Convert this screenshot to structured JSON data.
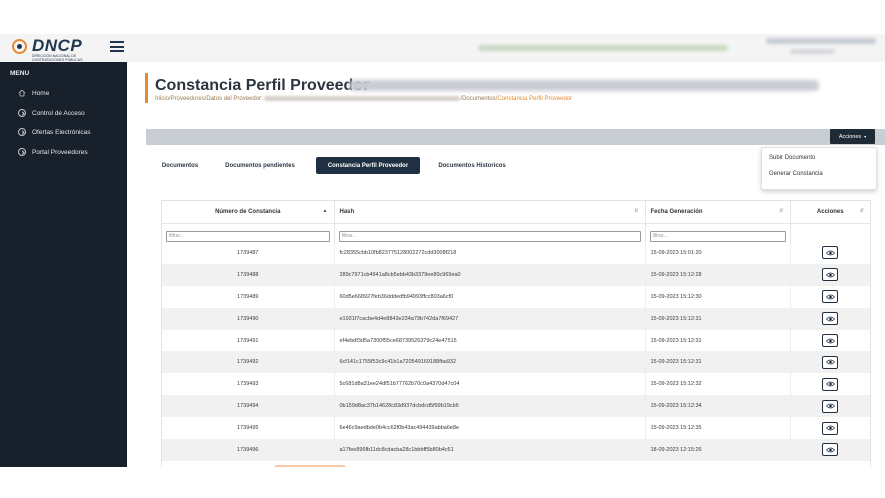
{
  "header": {
    "logo_text": "DNCP",
    "logo_subtitle": "DIRECCIÓN NACIONAL DE CONTRATACIONES PÚBLICAS"
  },
  "sidebar": {
    "menu_title": "MENU",
    "items": [
      {
        "label": "Home",
        "icon": "home-icon"
      },
      {
        "label": "Control de Acceso",
        "icon": "chevron-right-circle-icon"
      },
      {
        "label": "Ofertas Electrónicas",
        "icon": "chevron-right-circle-icon"
      },
      {
        "label": "Portal Proveedores",
        "icon": "chevron-right-circle-icon"
      }
    ]
  },
  "page": {
    "title": "Constancia Perfil Proveedor",
    "breadcrumb": {
      "part1": "Inicio/Proveedores/Datos del Proveedor: ",
      "part2": "/Documentos/",
      "current": "Constancia Perfil Proveedor"
    }
  },
  "actions": {
    "button_label": "Acciones",
    "menu_items": [
      "Subir Documento",
      "Generar Constancia"
    ]
  },
  "tabs": [
    "Documentos",
    "Documentos pendientes",
    "Constancia Perfil Proveedor",
    "Documentos Historicos"
  ],
  "active_tab": "Constancia Perfil Proveedor",
  "table": {
    "columns": [
      "Número de Constancia",
      "Hash",
      "Fecha Generación",
      "Acciones"
    ],
    "filter_placeholder": "filtrar...",
    "rows": [
      {
        "numero": "1739487",
        "hash": "fc28355cbb10fb823775128002272cdd3008f218",
        "fecha": "15-09-2023 15:01:20"
      },
      {
        "numero": "1739488",
        "hash": "289c7971cb4941a8cb5ebb43b3379ee80c969ea0",
        "fecha": "15-09-2023 15:12:28"
      },
      {
        "numero": "1739489",
        "hash": "60d5e668927feb36dddedfb94993ffcc803a6cf0",
        "fecha": "15-09-2023 15:12:30"
      },
      {
        "numero": "1739490",
        "hash": "e1931f7cacbe4d4e8843e234a79b742da7f69427",
        "fecha": "15-09-2023 15:12:31"
      },
      {
        "numero": "1739491",
        "hash": "ef4ebdf3d5a7300f55ce68739526379c24e47515",
        "fecha": "15-09-2023 15:12:31"
      },
      {
        "numero": "1739492",
        "hash": "6cf141c1755f53c9c41b1a720549169188fba932",
        "fecha": "15-09-2023 15:12:31"
      },
      {
        "numero": "1739493",
        "hash": "5c681d8a31ee24df51b77762b70c0a4370d47c04",
        "fecha": "15-09-2023 15:12:32"
      },
      {
        "numero": "1739494",
        "hash": "0b159d8ac37b14628c83d937dcbdcd5f99b19cb6",
        "fecha": "15-09-2023 15:12:34"
      },
      {
        "numero": "1739495",
        "hash": "6e46c9aedbde0b4cc62f0b43ac494439abba6e8e",
        "fecha": "15-09-2023 15:12:35"
      },
      {
        "numero": "1739496",
        "hash": "a17fee896fb11dc8cdacba28c1bbbff5b80b4c61",
        "fecha": "18-09-2023 12:15:26"
      }
    ]
  },
  "colors": {
    "sidebar_bg": "#17202b",
    "accent_orange": "#e58a2f",
    "active_tab_bg": "#1e3041"
  }
}
